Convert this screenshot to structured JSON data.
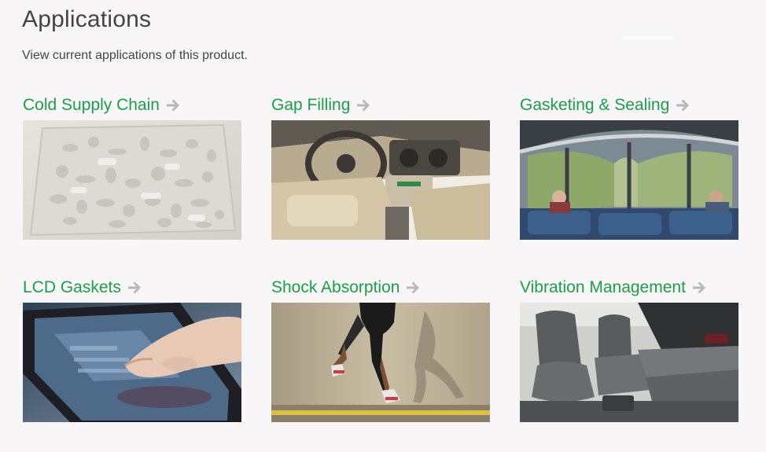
{
  "header": {
    "title": "Applications",
    "subtitle": "View current applications of this product."
  },
  "applications": [
    {
      "label": "Cold Supply Chain"
    },
    {
      "label": "Gap Filling"
    },
    {
      "label": "Gasketing & Sealing"
    },
    {
      "label": "LCD Gaskets"
    },
    {
      "label": "Shock Absorption"
    },
    {
      "label": "Vibration Management"
    }
  ],
  "colors": {
    "background": "#f8f6f6",
    "link": "#1aa04a",
    "arrow": "#b8b8b8",
    "heading": "#444444"
  },
  "icons": {
    "arrow": "arrow-right-icon"
  }
}
